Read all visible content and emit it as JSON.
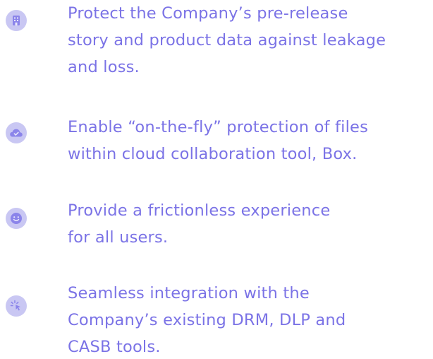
{
  "accent_color": "#7b73e6",
  "icon_bg_color": "#c9c7f3",
  "items": [
    {
      "icon": "building-icon",
      "lines": [
        "Protect the Company’s pre-release",
        "story and product data against leakage",
        "and loss."
      ]
    },
    {
      "icon": "cloud-check-icon",
      "lines": [
        "Enable “on-the-fly” protection of files",
        "within cloud collaboration tool, Box."
      ]
    },
    {
      "icon": "smiley-icon",
      "lines": [
        "Provide a frictionless experience",
        "for all users."
      ]
    },
    {
      "icon": "cursor-click-icon",
      "lines": [
        "Seamless integration with the",
        "Company’s existing DRM, DLP and",
        "CASB tools."
      ]
    }
  ]
}
